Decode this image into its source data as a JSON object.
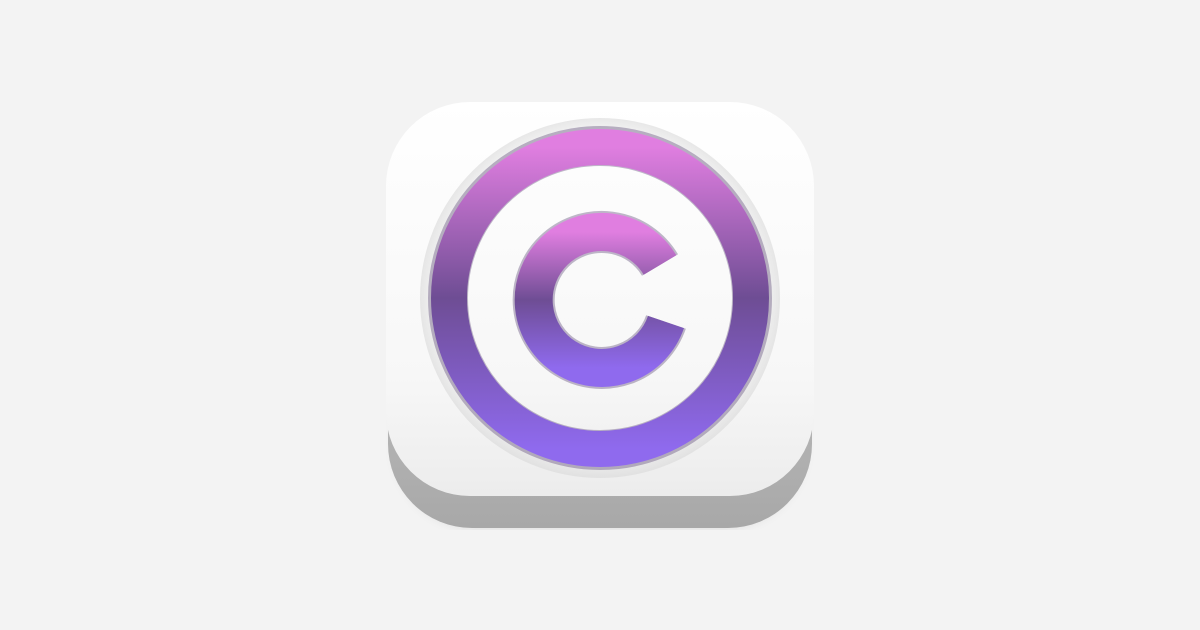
{
  "icon": {
    "name": "copyright-icon",
    "colors": {
      "background": "#f3f3f3",
      "tile_face": "#ffffff",
      "tile_side": "#bdbdbd",
      "ring_top": "#e07ee0",
      "ring_mid": "#6e4d94",
      "ring_bottom": "#8f6aee"
    }
  }
}
